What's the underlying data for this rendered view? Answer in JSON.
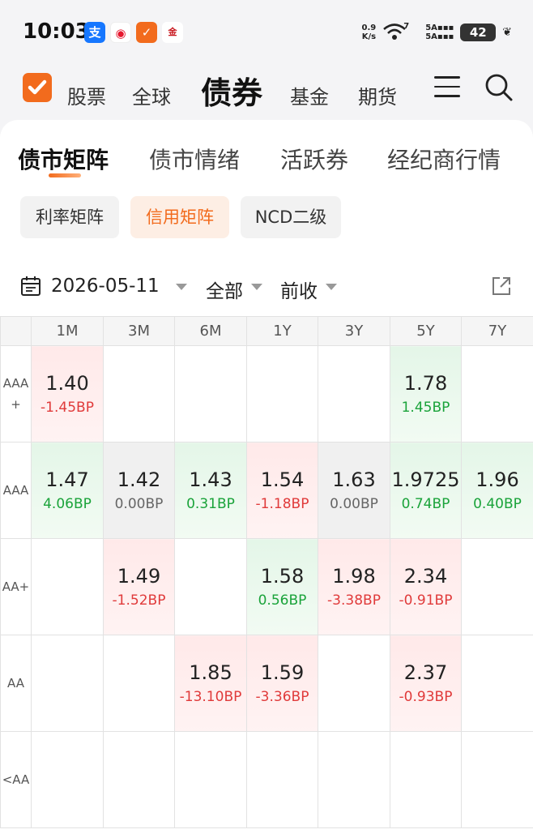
{
  "status_bar": {
    "time": "10:03",
    "apps": [
      {
        "icon": "alipay-icon",
        "glyph": "支",
        "color": "#1677ff"
      },
      {
        "icon": "weibo-icon",
        "glyph": "◉",
        "color": "#e6162d"
      },
      {
        "icon": "tonghuashun-icon",
        "glyph": "✓",
        "color": "#f26b1d"
      },
      {
        "icon": "jinrongjie-icon",
        "glyph": "金",
        "color": "#c8161d"
      }
    ],
    "net_speed_value": "0.9",
    "net_speed_unit": "K/s",
    "wifi_badge": "7",
    "signal_top": "5A",
    "signal_bottom": "5A",
    "battery": "42"
  },
  "top_nav": {
    "items": [
      "股票",
      "全球",
      "债券",
      "基金",
      "期货"
    ],
    "active": "债券"
  },
  "sub_tabs": {
    "items": [
      "债市矩阵",
      "债市情绪",
      "活跃券",
      "经纪商行情"
    ],
    "active": "债市矩阵"
  },
  "chips": {
    "items": [
      "利率矩阵",
      "信用矩阵",
      "NCD二级"
    ],
    "active": "信用矩阵"
  },
  "filters": {
    "date": "2026-05-11",
    "scope": "全部",
    "basis": "前收"
  },
  "matrix": {
    "columns": [
      "1M",
      "3M",
      "6M",
      "1Y",
      "3Y",
      "5Y",
      "7Y"
    ],
    "rows": [
      {
        "label_line1": "AAA",
        "label_line2": "+",
        "cells": [
          {
            "value": "1.40",
            "change": "-1.45BP",
            "tone": "up"
          },
          null,
          null,
          null,
          null,
          {
            "value": "1.78",
            "change": "1.45BP",
            "tone": "down"
          },
          null
        ]
      },
      {
        "label_line1": "AAA",
        "label_line2": "",
        "cells": [
          {
            "value": "1.47",
            "change": "4.06BP",
            "tone": "down"
          },
          {
            "value": "1.42",
            "change": "0.00BP",
            "tone": "flat"
          },
          {
            "value": "1.43",
            "change": "0.31BP",
            "tone": "down"
          },
          {
            "value": "1.54",
            "change": "-1.18BP",
            "tone": "up"
          },
          {
            "value": "1.63",
            "change": "0.00BP",
            "tone": "flat"
          },
          {
            "value": "1.9725",
            "change": "0.74BP",
            "tone": "down"
          },
          {
            "value": "1.96",
            "change": "0.40BP",
            "tone": "down"
          }
        ]
      },
      {
        "label_line1": "AA+",
        "label_line2": "",
        "cells": [
          null,
          {
            "value": "1.49",
            "change": "-1.52BP",
            "tone": "up"
          },
          null,
          {
            "value": "1.58",
            "change": "0.56BP",
            "tone": "down"
          },
          {
            "value": "1.98",
            "change": "-3.38BP",
            "tone": "up"
          },
          {
            "value": "2.34",
            "change": "-0.91BP",
            "tone": "up"
          },
          null
        ]
      },
      {
        "label_line1": "AA",
        "label_line2": "",
        "cells": [
          null,
          null,
          {
            "value": "1.85",
            "change": "-13.10BP",
            "tone": "up"
          },
          {
            "value": "1.59",
            "change": "-3.36BP",
            "tone": "up"
          },
          null,
          {
            "value": "2.37",
            "change": "-0.93BP",
            "tone": "up"
          },
          null
        ]
      },
      {
        "label_line1": "<AA",
        "label_line2": "",
        "cells": [
          null,
          null,
          null,
          null,
          null,
          null,
          null
        ]
      }
    ]
  },
  "colors": {
    "accent": "#f26b1d",
    "negative_change": "#e03a3a",
    "positive_change": "#1aa33a",
    "neutral_change": "#666666"
  }
}
